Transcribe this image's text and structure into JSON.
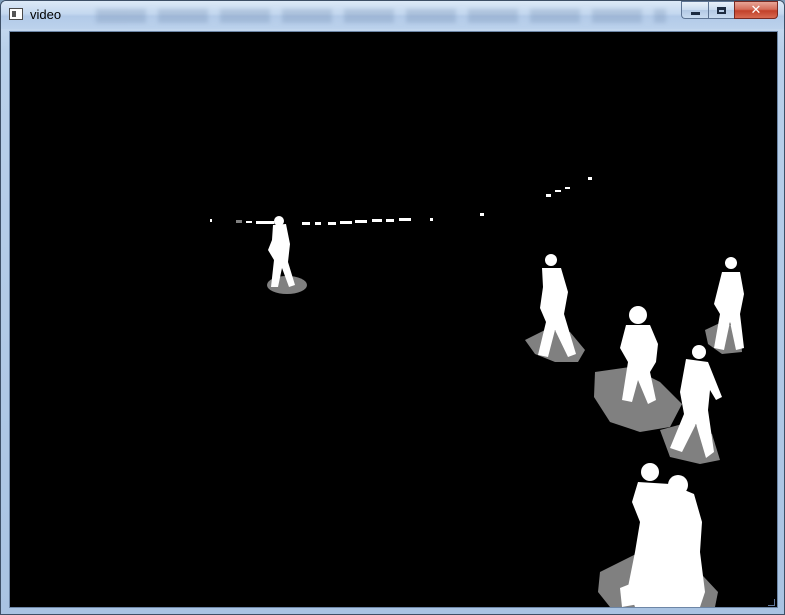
{
  "window": {
    "title": "video",
    "controls": {
      "minimize": "minimize-icon",
      "maximize": "maximize-icon",
      "close": "close-icon"
    }
  },
  "frame": {
    "description_colors": {
      "background": "#000000",
      "foreground": "#ffffff",
      "shadow": "#808080"
    }
  }
}
